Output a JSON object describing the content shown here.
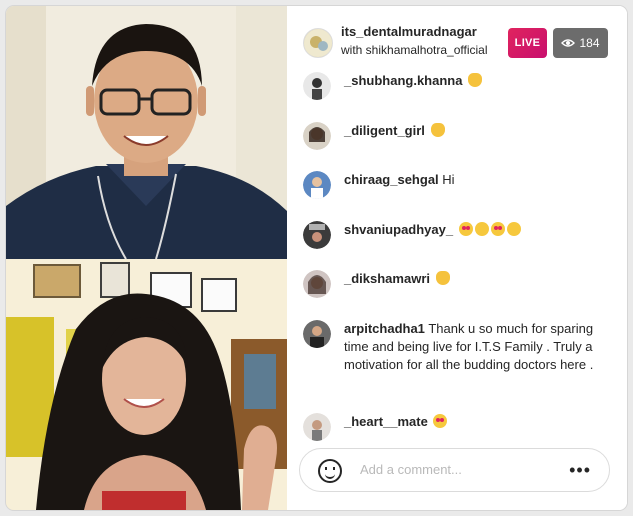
{
  "header": {
    "host_username": "its_dentalmuradnagar",
    "guest_line": "with shikhamalhotra_official",
    "live_label": "LIVE",
    "viewer_count": "184"
  },
  "comments": [
    {
      "user": "_shubhang.khanna",
      "text": "",
      "emoji": "hand"
    },
    {
      "user": "_diligent_girl",
      "text": "",
      "emoji": "hand"
    },
    {
      "user": "chiraag_sehgal",
      "text": "Hi",
      "emoji": ""
    },
    {
      "user": "shvaniupadhyay_",
      "text": "",
      "emoji": "love-kiss-love-kiss"
    },
    {
      "user": "_dikshamawri",
      "text": "",
      "emoji": "hand"
    },
    {
      "user": "arpitchadha1",
      "text": "Thank u so much for sparing time and being live for I.T.S Family . Truly a motivation for all the budding doctors here .",
      "emoji": ""
    },
    {
      "user": "_heart__mate",
      "text": "",
      "emoji": "love"
    }
  ],
  "input": {
    "placeholder": "Add a comment...",
    "more_label": "•••"
  },
  "colors": {
    "live_badge": "#d6196a",
    "viewer_badge": "#6c6c6c"
  }
}
